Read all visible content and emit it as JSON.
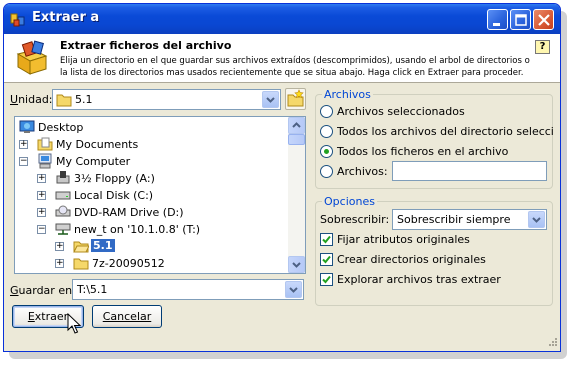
{
  "window": {
    "title": "Extraer a"
  },
  "header": {
    "title": "Extraer ficheros del archivo",
    "description": "Elija un directorio en el que guardar sus archivos extraídos (descomprimidos), usando el arbol de directorios o la lista de los directorios mas usados recientemente que se situa abajo. Haga click en Extraer para proceder.",
    "help_glyph": "?"
  },
  "unit": {
    "label_prefix": "",
    "label_u": "U",
    "label_rest": "nidad:",
    "value": "5.1"
  },
  "tree": {
    "items": [
      {
        "label": "Desktop",
        "icon": "desktop-icon"
      },
      {
        "label": "My Documents",
        "icon": "my-documents-icon"
      },
      {
        "label": "My Computer",
        "icon": "my-computer-icon"
      },
      {
        "label": "3½ Floppy (A:)",
        "icon": "floppy-drive-icon"
      },
      {
        "label": "Local Disk (C:)",
        "icon": "hard-disk-icon"
      },
      {
        "label": "DVD-RAM Drive (D:)",
        "icon": "dvd-drive-icon"
      },
      {
        "label": "new_t on '10.1.0.8' (T:)",
        "icon": "network-drive-icon"
      },
      {
        "label": "5.1",
        "icon": "folder-open-icon"
      },
      {
        "label": "7z-20090512",
        "icon": "folder-icon"
      }
    ]
  },
  "save_in": {
    "label_u": "G",
    "label_rest": "uardar en:",
    "value": "T:\\5.1"
  },
  "buttons": {
    "extract_u": "E",
    "extract_rest": "xtraer",
    "cancel": "Cancelar"
  },
  "archivos": {
    "legend": "Archivos",
    "options": [
      {
        "label": "Archivos seleccionados",
        "selected": false
      },
      {
        "label": "Todos los archivos del directorio seleccionado",
        "selected": false
      },
      {
        "label": "Todos los ficheros en el archivo",
        "selected": true
      },
      {
        "label": "Archivos:",
        "selected": false
      }
    ],
    "files_value": ""
  },
  "opciones": {
    "legend": "Opciones",
    "overwrite_label": "Sobrescribir:",
    "overwrite_value": "Sobrescribir siempre",
    "checks": [
      {
        "label": "Fijar atributos originales",
        "checked": true
      },
      {
        "label": "Crear directorios originales",
        "checked": true
      },
      {
        "label": "Explorar archivos tras extraer",
        "checked": true
      }
    ]
  },
  "colors": {
    "titlebar": "#0a4ad7",
    "dialog_bg": "#ece9d8",
    "group_legend": "#0046d5",
    "selection": "#316ac5"
  }
}
